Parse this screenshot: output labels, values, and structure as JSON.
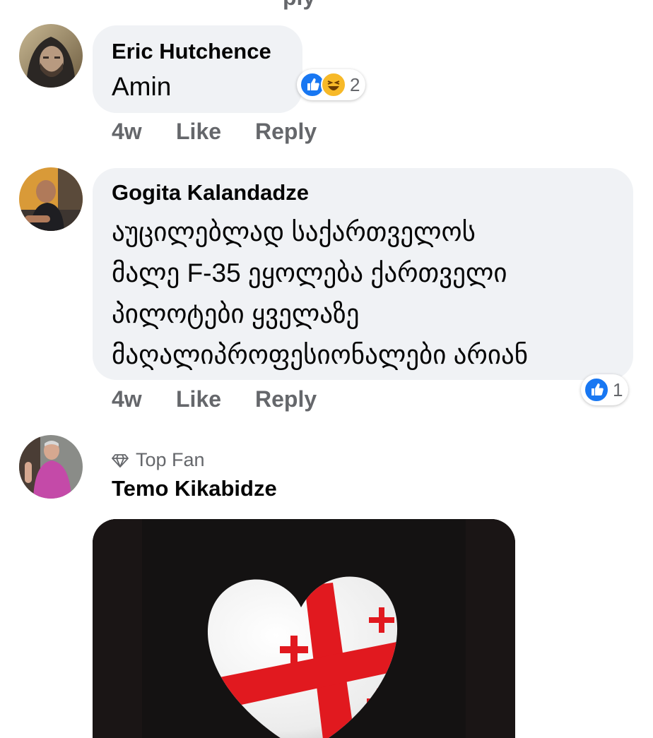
{
  "top_fragment": "ply",
  "comments": [
    {
      "author": "Eric Hutchence",
      "text": "Amin",
      "reaction_count": "2",
      "time": "4w",
      "like_label": "Like",
      "reply_label": "Reply"
    },
    {
      "author": "Gogita Kalandadze",
      "text_lines": [
        "აუცილებლად საქართველოს",
        "მალე F-35 ეყოლება ქართველი",
        "პილოტები ყველაზე",
        "მაღალიპროფესიონალები არიან"
      ],
      "reaction_count": "1",
      "time": "4w",
      "like_label": "Like",
      "reply_label": "Reply"
    },
    {
      "badge": "Top Fan",
      "author": "Temo Kikabidze"
    }
  ],
  "colors": {
    "bubble": "#f0f2f5",
    "secondary_text": "#65676b",
    "like_blue": "#1877f2",
    "haha_yellow": "#f7b928",
    "georgian_red": "#e1191f"
  }
}
